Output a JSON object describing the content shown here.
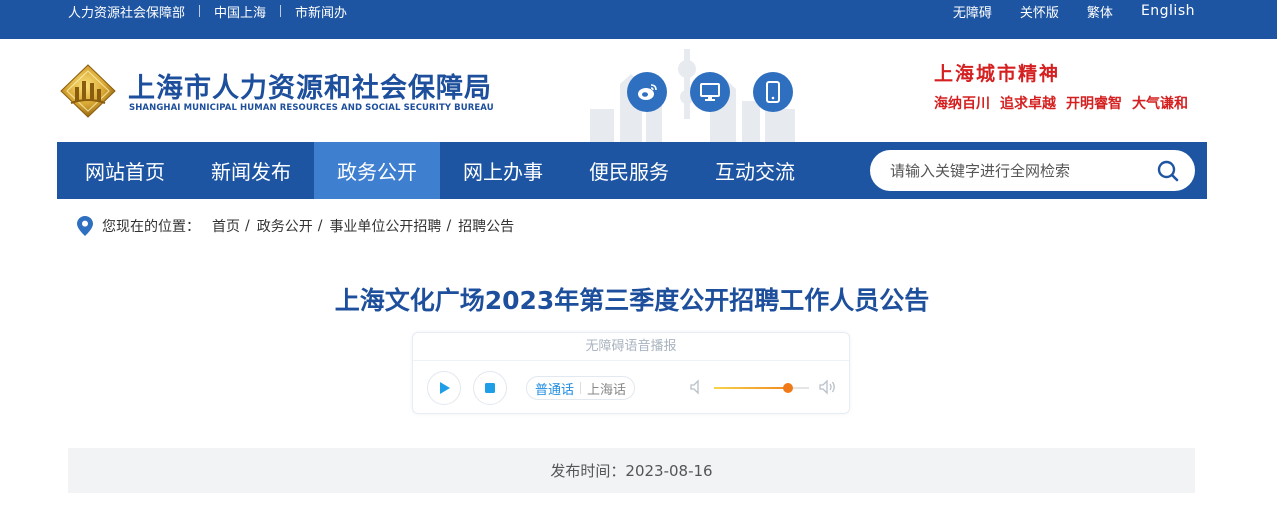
{
  "topbar": {
    "left_links": [
      "人力资源社会保障部",
      "中国上海",
      "市新闻办"
    ],
    "right_links": [
      "无障碍",
      "关怀版",
      "繁体",
      "English"
    ]
  },
  "header": {
    "title": "上海市人力资源和社会保障局",
    "subtitle": "SHANGHAI MUNICIPAL HUMAN RESOURCES AND SOCIAL SECURITY BUREAU",
    "icons": [
      "weibo-icon",
      "desktop-icon",
      "mobile-icon"
    ],
    "spirit_title": "上海城市精神",
    "spirit_items": [
      "海纳百川",
      "追求卓越",
      "开明睿智",
      "大气谦和"
    ]
  },
  "nav": {
    "items": [
      {
        "label": "网站首页",
        "active": false
      },
      {
        "label": "新闻发布",
        "active": false
      },
      {
        "label": "政务公开",
        "active": true
      },
      {
        "label": "网上办事",
        "active": false
      },
      {
        "label": "便民服务",
        "active": false
      },
      {
        "label": "互动交流",
        "active": false
      }
    ],
    "search_placeholder": "请输入关键字进行全网检索"
  },
  "breadcrumb": {
    "label": "您现在的位置：",
    "items": [
      "首页",
      "政务公开",
      "事业单位公开招聘",
      "招聘公告"
    ],
    "separator": "/"
  },
  "article": {
    "title": "上海文化广场2023年第三季度公开招聘工作人员公告",
    "publish": "发布时间：2023-08-16"
  },
  "player": {
    "title": "无障碍语音播报",
    "languages": [
      "普通话",
      "上海话"
    ],
    "selected_language": "普通话",
    "volume": 0.78
  },
  "colors": {
    "primary_blue": "#1e55a3",
    "active_tab": "#3f7fd0",
    "accent_red": "#d42020"
  }
}
